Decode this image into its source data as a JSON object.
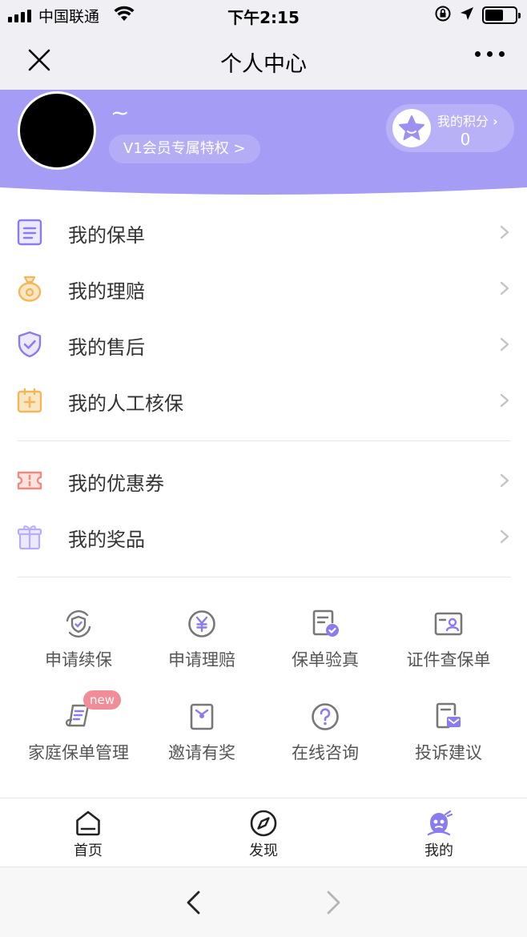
{
  "status_bar": {
    "carrier": "中国联通",
    "time": "下午2:15"
  },
  "nav": {
    "title": "个人中心"
  },
  "profile": {
    "nickname": "~",
    "vip_label": "V1会员专属特权 >",
    "points_label": "我的积分",
    "points_chevron": "›",
    "points_value": "0",
    "header_color": "#a49cf5"
  },
  "menu": {
    "group1": [
      {
        "label": "我的保单",
        "icon": "policy-icon"
      },
      {
        "label": "我的理赔",
        "icon": "claim-bag-icon"
      },
      {
        "label": "我的售后",
        "icon": "shield-check-icon"
      },
      {
        "label": "我的人工核保",
        "icon": "medical-kit-icon"
      }
    ],
    "group2": [
      {
        "label": "我的优惠券",
        "icon": "coupon-icon"
      },
      {
        "label": "我的奖品",
        "icon": "gift-icon"
      }
    ]
  },
  "grid": {
    "row1": [
      {
        "label": "申请续保",
        "icon": "renew-shield-icon"
      },
      {
        "label": "申请理赔",
        "icon": "yen-circle-icon"
      },
      {
        "label": "保单验真",
        "icon": "verify-doc-icon"
      },
      {
        "label": "证件查保单",
        "icon": "id-card-icon"
      }
    ],
    "row2": [
      {
        "label": "家庭保单管理",
        "icon": "scroll-icon"
      },
      {
        "label": "邀请有奖",
        "icon": "invite-icon"
      },
      {
        "label": "在线咨询",
        "icon": "question-circle-icon"
      },
      {
        "label": "投诉建议",
        "icon": "complaint-icon"
      }
    ],
    "new_badge": "new"
  },
  "tabbar": {
    "home": "首页",
    "discover": "发现",
    "mine": "我的"
  },
  "colors": {
    "accent": "#8a7cf0",
    "icon_gray": "#777777",
    "orange": "#f0b85a",
    "red": "#ee8a7f"
  }
}
